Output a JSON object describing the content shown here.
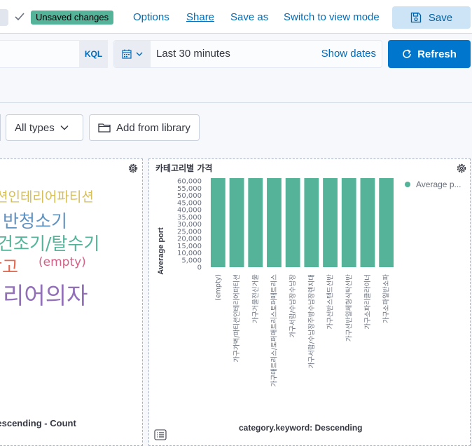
{
  "topbar": {
    "badge": "Unsaved changes",
    "options": "Options",
    "share": "Share",
    "save_as": "Save as",
    "switch_view": "Switch to view mode",
    "save": "Save"
  },
  "query": {
    "language": "KQL",
    "date_range": "Last 30 minutes",
    "show_dates": "Show dates",
    "refresh": "Refresh"
  },
  "toolbar": {
    "all_types": "All types",
    "add_from_library": "Add from library"
  },
  "left_panel": {
    "words": [
      {
        "text": "션인테리어파티션",
        "color": "#d6bf57"
      },
      {
        "text": "반청소기",
        "color": "#6092c0"
      },
      {
        "text": "건조기/탈수기",
        "color": "#54b399"
      },
      {
        "text": "장고",
        "color": "#e7664c"
      },
      {
        "text": "(empty)",
        "color": "#d36086"
      },
      {
        "text": "리어의자",
        "color": "#9170b8"
      }
    ],
    "footer": "Descending - Count"
  },
  "chart_data": {
    "type": "bar",
    "title": "카테고리별 가격",
    "ylabel": "Average port",
    "xlabel": "category.keyword: Descending",
    "legend": [
      "Average p..."
    ],
    "legend_position": "top-right",
    "ylim": [
      0,
      62000
    ],
    "yticks": [
      "60,000",
      "55,000",
      "50,000",
      "45,000",
      "40,000",
      "35,000",
      "30,000",
      "25,000",
      "20,000",
      "15,000",
      "10,000",
      "5,000",
      "0"
    ],
    "categories": [
      "(empty)",
      "가구가벽/파티션인테리어파티션",
      "가구거울전신거울",
      "가구매트리스/토퍼매트리스토퍼매트리스",
      "가구서랍/수납장수납장",
      "가구서랍/수납장주방수납장렌지대",
      "가구선반스탠드선반",
      "가구선반일체형식탁선반",
      "가구소파리클라이너",
      "가구소파일반소파"
    ],
    "values": [
      62000,
      62000,
      62000,
      62000,
      62000,
      62000,
      62000,
      62000,
      62000,
      62000
    ],
    "bar_color": "#54b399"
  }
}
